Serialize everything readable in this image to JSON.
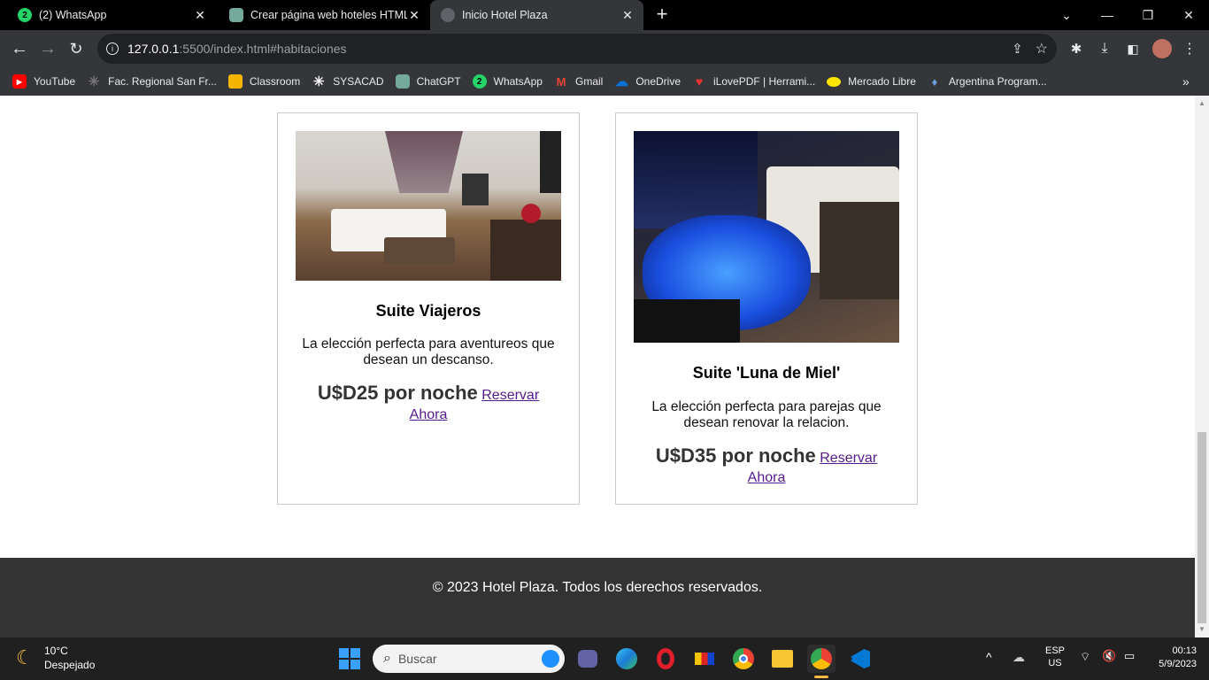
{
  "tabs": [
    {
      "title": "(2) WhatsApp",
      "favicon": "whatsapp-icon"
    },
    {
      "title": "Crear página web hoteles HTML/",
      "favicon": "chatgpt-icon"
    },
    {
      "title": "Inicio Hotel Plaza",
      "favicon": "globe-icon"
    }
  ],
  "new_tab_label": "+",
  "address": {
    "host": "127.0.0.1",
    "path": ":5500/index.html#habitaciones"
  },
  "bookmarks": [
    {
      "label": "YouTube",
      "icon": "youtube-icon",
      "color": "#ff0000"
    },
    {
      "label": "Fac. Regional San Fr...",
      "icon": "utn-icon",
      "color": "#555555"
    },
    {
      "label": "Classroom",
      "icon": "classroom-icon",
      "color": "#f4b400"
    },
    {
      "label": "SYSACAD",
      "icon": "sysacad-icon",
      "color": "#ffffff"
    },
    {
      "label": "ChatGPT",
      "icon": "chatgpt-icon",
      "color": "#74aa9c"
    },
    {
      "label": "WhatsApp",
      "icon": "whatsapp-icon",
      "color": "#25d366"
    },
    {
      "label": "Gmail",
      "icon": "gmail-icon",
      "color": "#ea4335"
    },
    {
      "label": "OneDrive",
      "icon": "onedrive-icon",
      "color": "#0a72d4"
    },
    {
      "label": "iLovePDF | Herrami...",
      "icon": "ilovepdf-icon",
      "color": "#e5322d"
    },
    {
      "label": "Mercado Libre",
      "icon": "mercadolibre-icon",
      "color": "#ffe600"
    },
    {
      "label": "Argentina Program...",
      "icon": "argentina-program-icon",
      "color": "#6ca0dc"
    }
  ],
  "rooms": [
    {
      "name": "Suite Viajeros",
      "description": "La elección perfecta para aventureos que desean un descanso.",
      "price": "U$D25 por noche",
      "link": "Reservar Ahora"
    },
    {
      "name": "Suite 'Luna de Miel'",
      "description": "La elección perfecta para parejas que desean renovar la relacion.",
      "price": "U$D35 por noche",
      "link": "Reservar Ahora"
    }
  ],
  "footer": {
    "text": "© 2023 Hotel Plaza. Todos los derechos reservados."
  },
  "taskbar": {
    "weather_temp": "10°C",
    "weather_desc": "Despejado",
    "search_placeholder": "Buscar",
    "lang_top": "ESP",
    "lang_bottom": "US",
    "time": "00:13",
    "date": "5/9/2023"
  },
  "colors": {
    "footer_bg": "#333333",
    "link": "#551a8b",
    "chrome_bg": "#35363a"
  }
}
